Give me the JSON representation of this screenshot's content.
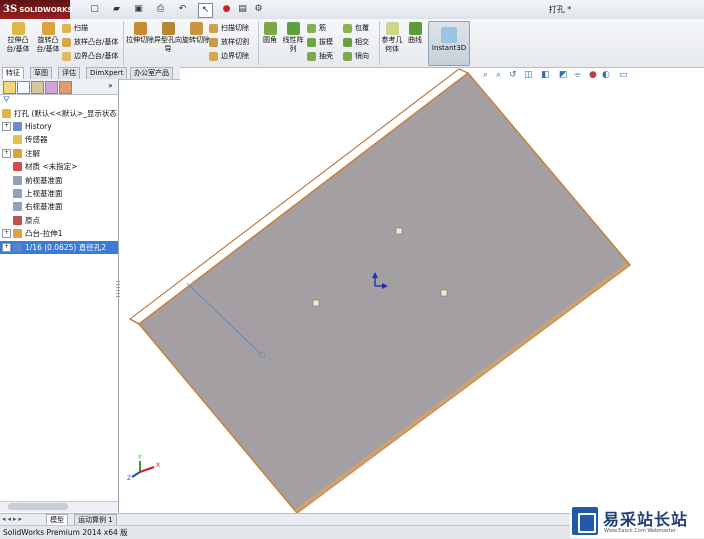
{
  "app": {
    "logo_text": "SOLIDWORKS",
    "logo_mark": "3S",
    "doc_title": "打孔 *"
  },
  "ribbon": {
    "extrude_boss": "拉伸凸台/基体",
    "revolve_boss": "旋转凸台/基体",
    "sweep": "扫描",
    "loft_boss": "放样凸台/基体",
    "boundary_boss": "边界凸台/基体",
    "extrude_cut": "拉伸切除",
    "hole_wizard": "异型孔向导",
    "revolve_cut": "旋转切除",
    "sweep_cut": "扫描切除",
    "loft_cut": "放样切割",
    "boundary_cut": "边界切除",
    "fillet": "圆角",
    "linear_pattern": "线性阵列",
    "rib": "筋",
    "draft": "拔模",
    "shell": "抽壳",
    "wrap": "包覆",
    "intersect": "相交",
    "mirror": "镜向",
    "ref_geometry": "参考几何体",
    "curves": "曲线",
    "instant3d": "Instant3D"
  },
  "cmd_tabs": [
    "特征",
    "草图",
    "评估",
    "DimXpert",
    "办公室产品"
  ],
  "tree": {
    "root": "打孔 (默认<<默认>_显示状态",
    "nodes": [
      {
        "label": "History",
        "expand": "+"
      },
      {
        "label": "传感器",
        "expand": ""
      },
      {
        "label": "注解",
        "expand": "+"
      },
      {
        "label": "材质 <未指定>",
        "expand": ""
      },
      {
        "label": "前视基准面",
        "expand": ""
      },
      {
        "label": "上视基准面",
        "expand": ""
      },
      {
        "label": "右视基准面",
        "expand": ""
      },
      {
        "label": "原点",
        "expand": ""
      },
      {
        "label": "凸台-拉伸1",
        "expand": "+"
      },
      {
        "label": "1/16 (0.0625) 直径孔2",
        "expand": "+"
      }
    ]
  },
  "bottom_tabs": [
    "模型",
    "运动算例 1"
  ],
  "status_text": "SolidWorks Premium 2014 x64 版",
  "watermark": {
    "title": "易采站长站",
    "sub": "Www.Easck.Com Webmaster"
  },
  "colors": {
    "accent_red": "#9a1f1f",
    "selection": "#3d7ad6",
    "part_face": "#a39fa3",
    "part_edge": "#c9803a"
  }
}
